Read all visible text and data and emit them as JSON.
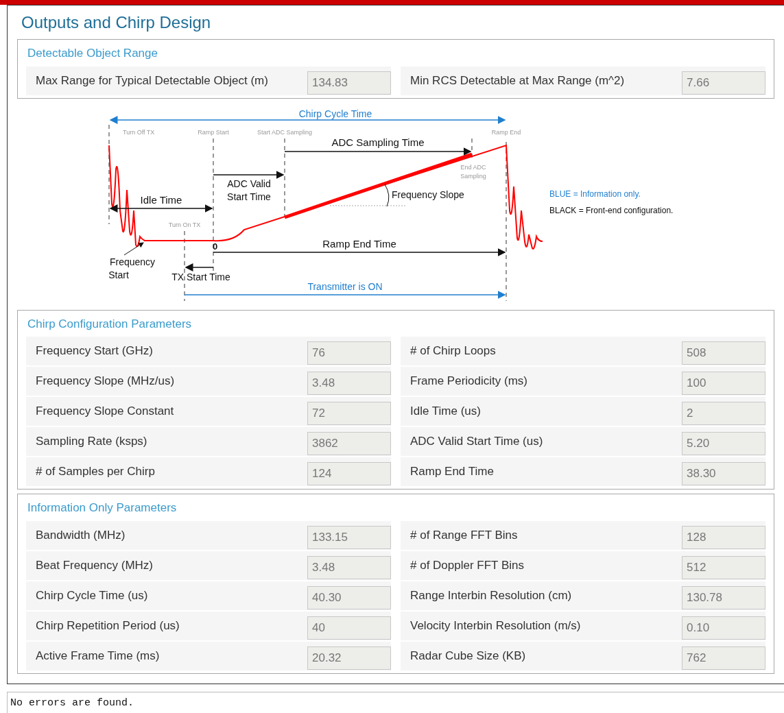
{
  "title": "Outputs and Chirp Design",
  "detectable": {
    "title": "Detectable Object Range",
    "fields": [
      {
        "label": "Max Range for Typical Detectable Object (m)",
        "value": "134.83"
      },
      {
        "label": "Min RCS Detectable at Max Range (m^2)",
        "value": "7.66"
      }
    ]
  },
  "diagram": {
    "labels": [
      {
        "text": "Chirp Cycle Time",
        "kind": "info"
      },
      {
        "text": "Turn Off TX",
        "kind": "marker"
      },
      {
        "text": "Ramp Start",
        "kind": "marker"
      },
      {
        "text": "Start ADC Sampling",
        "kind": "marker"
      },
      {
        "text": "Ramp End",
        "kind": "marker"
      },
      {
        "text": "ADC Sampling Time",
        "kind": "config"
      },
      {
        "text": "End ADC",
        "kind": "marker"
      },
      {
        "text": "Sampling",
        "kind": "marker"
      },
      {
        "text": "ADC Valid",
        "kind": "config"
      },
      {
        "text": "Start Time",
        "kind": "config"
      },
      {
        "text": "Idle Time",
        "kind": "config"
      },
      {
        "text": "Frequency Slope",
        "kind": "config"
      },
      {
        "text": "Turn On TX",
        "kind": "marker"
      },
      {
        "text": "0",
        "kind": "config"
      },
      {
        "text": "Ramp End Time",
        "kind": "config"
      },
      {
        "text": "Frequency",
        "kind": "config"
      },
      {
        "text": "Start",
        "kind": "config"
      },
      {
        "text": "TX Start Time",
        "kind": "config"
      },
      {
        "text": "Transmitter is ON",
        "kind": "info"
      },
      {
        "text": "BLUE = Information only.",
        "kind": "info"
      },
      {
        "text": "BLACK = Front-end configuration.",
        "kind": "config"
      }
    ]
  },
  "chirp": {
    "title": "Chirp Configuration Parameters",
    "fields": [
      {
        "label": "Frequency Start (GHz)",
        "value": "76"
      },
      {
        "label": "# of Chirp Loops",
        "value": "508"
      },
      {
        "label": "Frequency Slope (MHz/us)",
        "value": "3.48"
      },
      {
        "label": "Frame Periodicity (ms)",
        "value": "100"
      },
      {
        "label": "Frequency Slope Constant",
        "value": "72"
      },
      {
        "label": "Idle Time (us)",
        "value": "2"
      },
      {
        "label": "Sampling Rate (ksps)",
        "value": "3862"
      },
      {
        "label": "ADC Valid Start Time (us)",
        "value": "5.20"
      },
      {
        "label": "# of Samples per Chirp",
        "value": "124"
      },
      {
        "label": "Ramp End Time",
        "value": "38.30"
      }
    ]
  },
  "info": {
    "title": "Information Only Parameters",
    "fields": [
      {
        "label": "Bandwidth (MHz)",
        "value": "133.15"
      },
      {
        "label": "# of Range FFT Bins",
        "value": "128"
      },
      {
        "label": "Beat Frequency (MHz)",
        "value": "3.48"
      },
      {
        "label": "# of Doppler FFT Bins",
        "value": "512"
      },
      {
        "label": "Chirp Cycle Time (us)",
        "value": "40.30"
      },
      {
        "label": "Range Interbin Resolution (cm)",
        "value": "130.78"
      },
      {
        "label": "Chirp Repetition Period (us)",
        "value": "40"
      },
      {
        "label": "Velocity Interbin Resolution (m/s)",
        "value": "0.10"
      },
      {
        "label": "Active Frame Time (ms)",
        "value": "20.32"
      },
      {
        "label": "Radar Cube Size (KB)",
        "value": "762"
      }
    ]
  },
  "status": "No errors are found."
}
